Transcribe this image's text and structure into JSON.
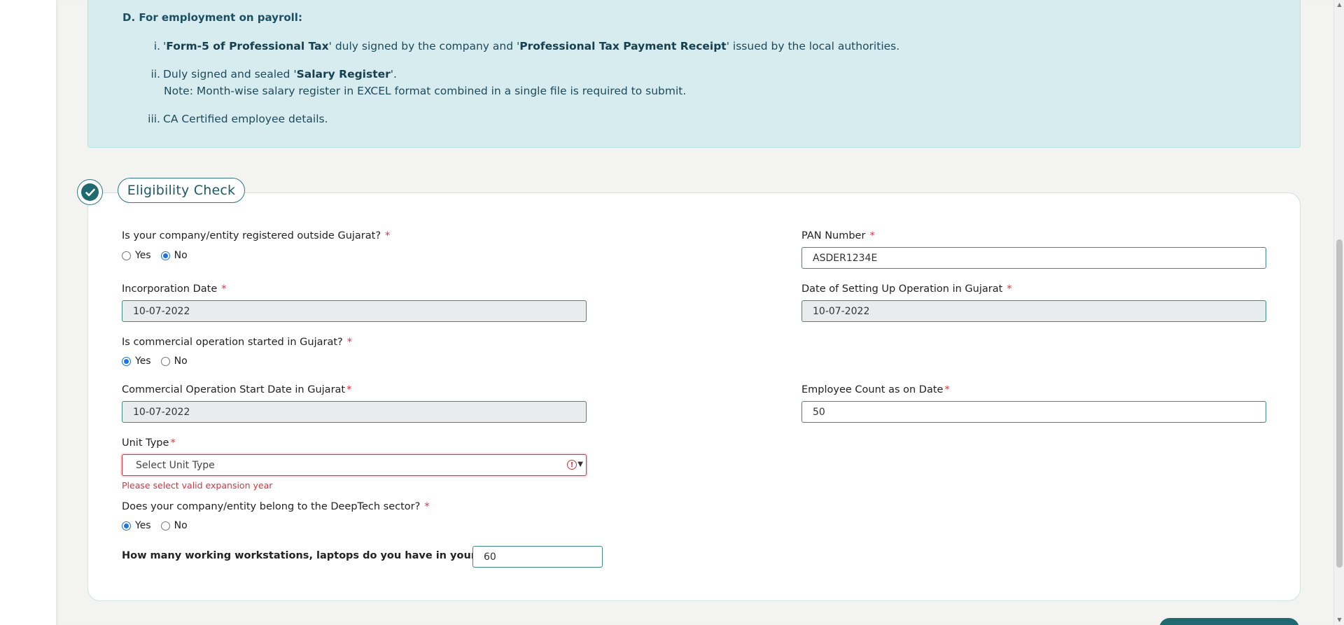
{
  "info": {
    "heading": "D. For employment on payroll:",
    "items": [
      {
        "num": "i.",
        "pre": "'",
        "b1": "Form-5 of Professional Tax",
        "mid": "' duly signed by the company and '",
        "b2": "Professional Tax Payment Receipt",
        "post": "' issued by the local authorities."
      },
      {
        "num": "ii.",
        "pre": "Duly signed and sealed '",
        "b1": "Salary Register",
        "post": "'.",
        "note": "Note: Month-wise salary register in EXCEL format combined in a single file is required to submit."
      },
      {
        "num": "iii.",
        "text": "CA Certified employee details."
      }
    ]
  },
  "section": {
    "title": "Eligibility Check",
    "icon": "check-icon"
  },
  "form": {
    "registered_outside": {
      "label": "Is your company/entity registered outside Gujarat?",
      "yes": "Yes",
      "no": "No",
      "selected": "No"
    },
    "pan": {
      "label": "PAN Number",
      "value": "ASDER1234E"
    },
    "incorporation_date": {
      "label": "Incorporation Date",
      "value": "10-07-2022"
    },
    "setup_date": {
      "label": "Date of Setting Up Operation in Gujarat",
      "value": "10-07-2022"
    },
    "commercial_started": {
      "label": "Is commercial operation started in Gujarat?",
      "yes": "Yes",
      "no": "No",
      "selected": "Yes"
    },
    "commercial_start_date": {
      "label": "Commercial Operation Start Date in Gujarat",
      "value": "10-07-2022"
    },
    "employee_count": {
      "label": "Employee Count as on Date",
      "value": "50"
    },
    "unit_type": {
      "label": "Unit Type",
      "placeholder": "Select Unit Type",
      "error": "Please select valid expansion year"
    },
    "deeptech": {
      "label": "Does your company/entity belong to the DeepTech sector?",
      "yes": "Yes",
      "no": "No",
      "selected": "Yes"
    },
    "workstations": {
      "label": "How many working workstations, laptops do you have in your company?",
      "value": "60"
    }
  },
  "required_mark": "*"
}
